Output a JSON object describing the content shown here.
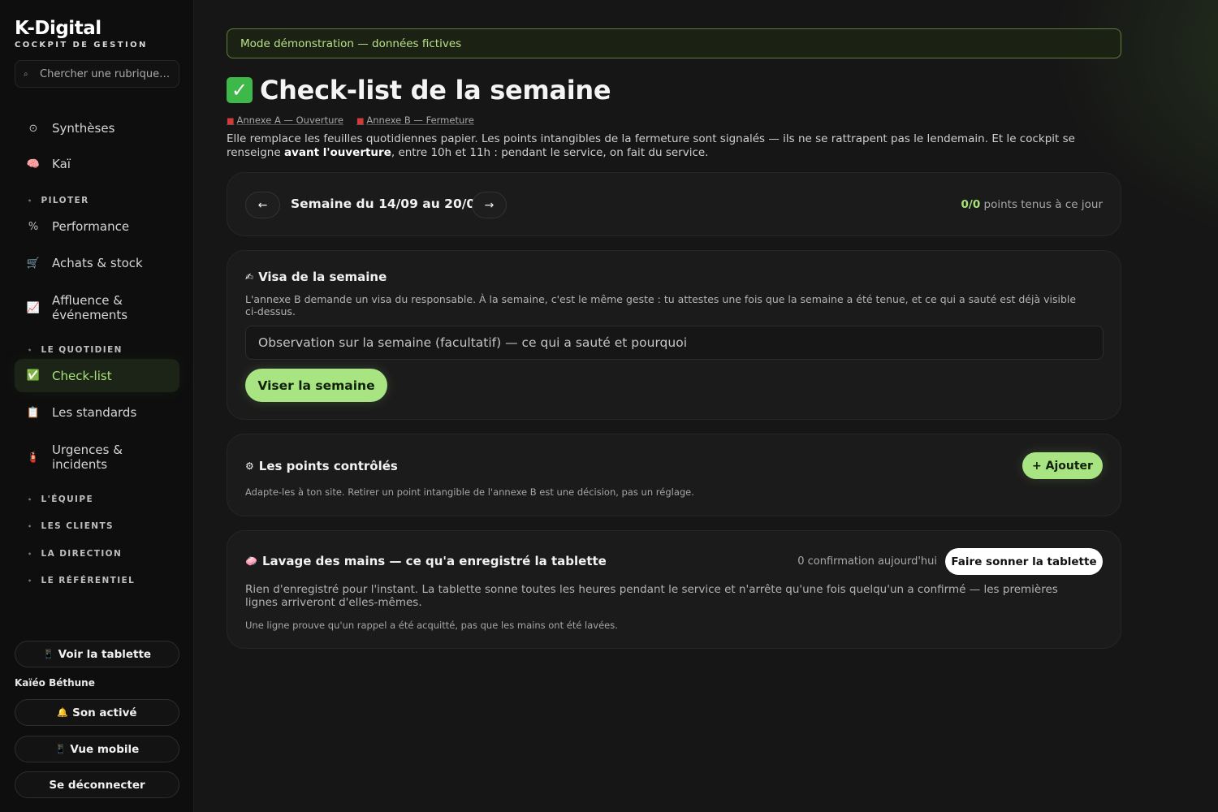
{
  "brand": {
    "title": "K-Digital",
    "subtitle": "COCKPIT DE GESTION"
  },
  "search": {
    "placeholder": "Chercher une rubrique…",
    "icon": "search-icon"
  },
  "sidebar": {
    "items": [
      {
        "id": "syntheses",
        "label": "Synthèses",
        "icon": "⊙"
      },
      {
        "id": "kai",
        "label": "Kaï",
        "icon": "🧠"
      }
    ],
    "sections": {
      "piloter": "PILOTER",
      "quotidien": "LE QUOTIDIEN",
      "equipe": "L'ÉQUIPE",
      "clients": "LES CLIENTS",
      "direction": "LA DIRECTION",
      "referentiel": "LE RÉFÉRENTIEL"
    },
    "piloter_items": [
      {
        "label": "Performance",
        "icon": "%"
      },
      {
        "label": "Achats & stock",
        "icon": "🛒"
      },
      {
        "label": "Affluence & événements",
        "icon": "📈"
      }
    ],
    "quotidien_items": [
      {
        "label": "Check-list",
        "icon": "✅"
      },
      {
        "label": "Les standards",
        "icon": "📋"
      },
      {
        "label": "Urgences & incidents",
        "icon": "🧯"
      }
    ],
    "tablet_button": "Voir la tablette",
    "user_name": "Kaïéo Béthune",
    "sound_button": "Son activé",
    "mobile_button": "Vue mobile",
    "logout_button": "Se déconnecter"
  },
  "main": {
    "banner": "Mode démonstration — données fictives",
    "title": "Check-list de la semaine",
    "annexes": [
      "Annexe A — Ouverture",
      "Annexe B — Fermeture"
    ],
    "intro_part1": "Elle remplace les feuilles quotidiennes papier. Les points intangibles de la fermeture sont signalés — ils ne se rattrapent pas le lendemain. Et le cockpit se renseigne ",
    "intro_bold": "avant l'ouverture",
    "intro_part2": ", entre 10h et 11h : pendant le service, on fait du service.",
    "week": {
      "label": "Semaine du 14/09 au 20/09",
      "score": "0/0",
      "score_label": " points tenus à ce jour"
    },
    "visa": {
      "title": "Visa de la semaine",
      "description": "L'annexe B demande un visa du responsable. À la semaine, c'est le même geste : tu attestes une fois que la semaine a été tenue, et ce qui a sauté est déjà visible ci-dessus.",
      "placeholder": "Observation sur la semaine (facultatif) — ce qui a sauté et pourquoi",
      "button": "Viser la semaine"
    },
    "points": {
      "title": "Les points contrôlés",
      "description": "Adapte-les à ton site. Retirer un point intangible de l'annexe B est une décision, pas un réglage.",
      "add_button": "+ Ajouter"
    },
    "wash": {
      "title": "Lavage des mains — ce qu'a enregistré la tablette",
      "confirmations": "0 confirmation aujourd'hui",
      "ring_button": "Faire sonner la tablette",
      "description": "Rien d'enregistré pour l'instant. La tablette sonne toutes les heures pendant le service et n'arrête qu'une fois quelqu'un a confirmé — les premières lignes arriveront d'elles-mêmes.",
      "note": "Une ligne prouve qu'un rappel a été acquitté, pas que les mains ont été lavées."
    }
  },
  "colors": {
    "accent": "#a9e483",
    "banner_border": "#5f7f3a",
    "background": "#161616"
  }
}
